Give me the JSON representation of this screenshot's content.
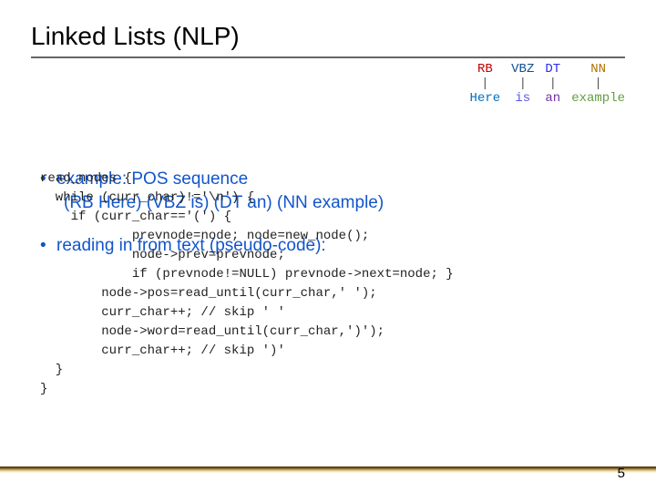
{
  "title": "Linked Lists (NLP)",
  "tree": {
    "tags": [
      "RB",
      "VBZ",
      "DT",
      "NN"
    ],
    "words": [
      "Here",
      "is",
      "an",
      "example"
    ]
  },
  "bullets": {
    "b1": "example: POS sequence",
    "b2": "(RB Here) (VBZ is) (DT an) (NN example)",
    "b3": "reading in from text (pseudo-code):"
  },
  "code_lines": [
    "read_nodes {",
    "  while (curr_char)!='\\n') {",
    "    if (curr_char=='(') {",
    "      prevnode=node; node=new_node();",
    "      node->prev=prevnode;",
    "      if (prevnode!=NULL) prevnode->next=node; }",
    "    node->pos=read_until(curr_char,' ');",
    "    curr_char++; // skip ' '",
    "    node->word=read_until(curr_char,')');",
    "    curr_char++; // skip ')'",
    "  }",
    "}"
  ],
  "pagenum": "5"
}
